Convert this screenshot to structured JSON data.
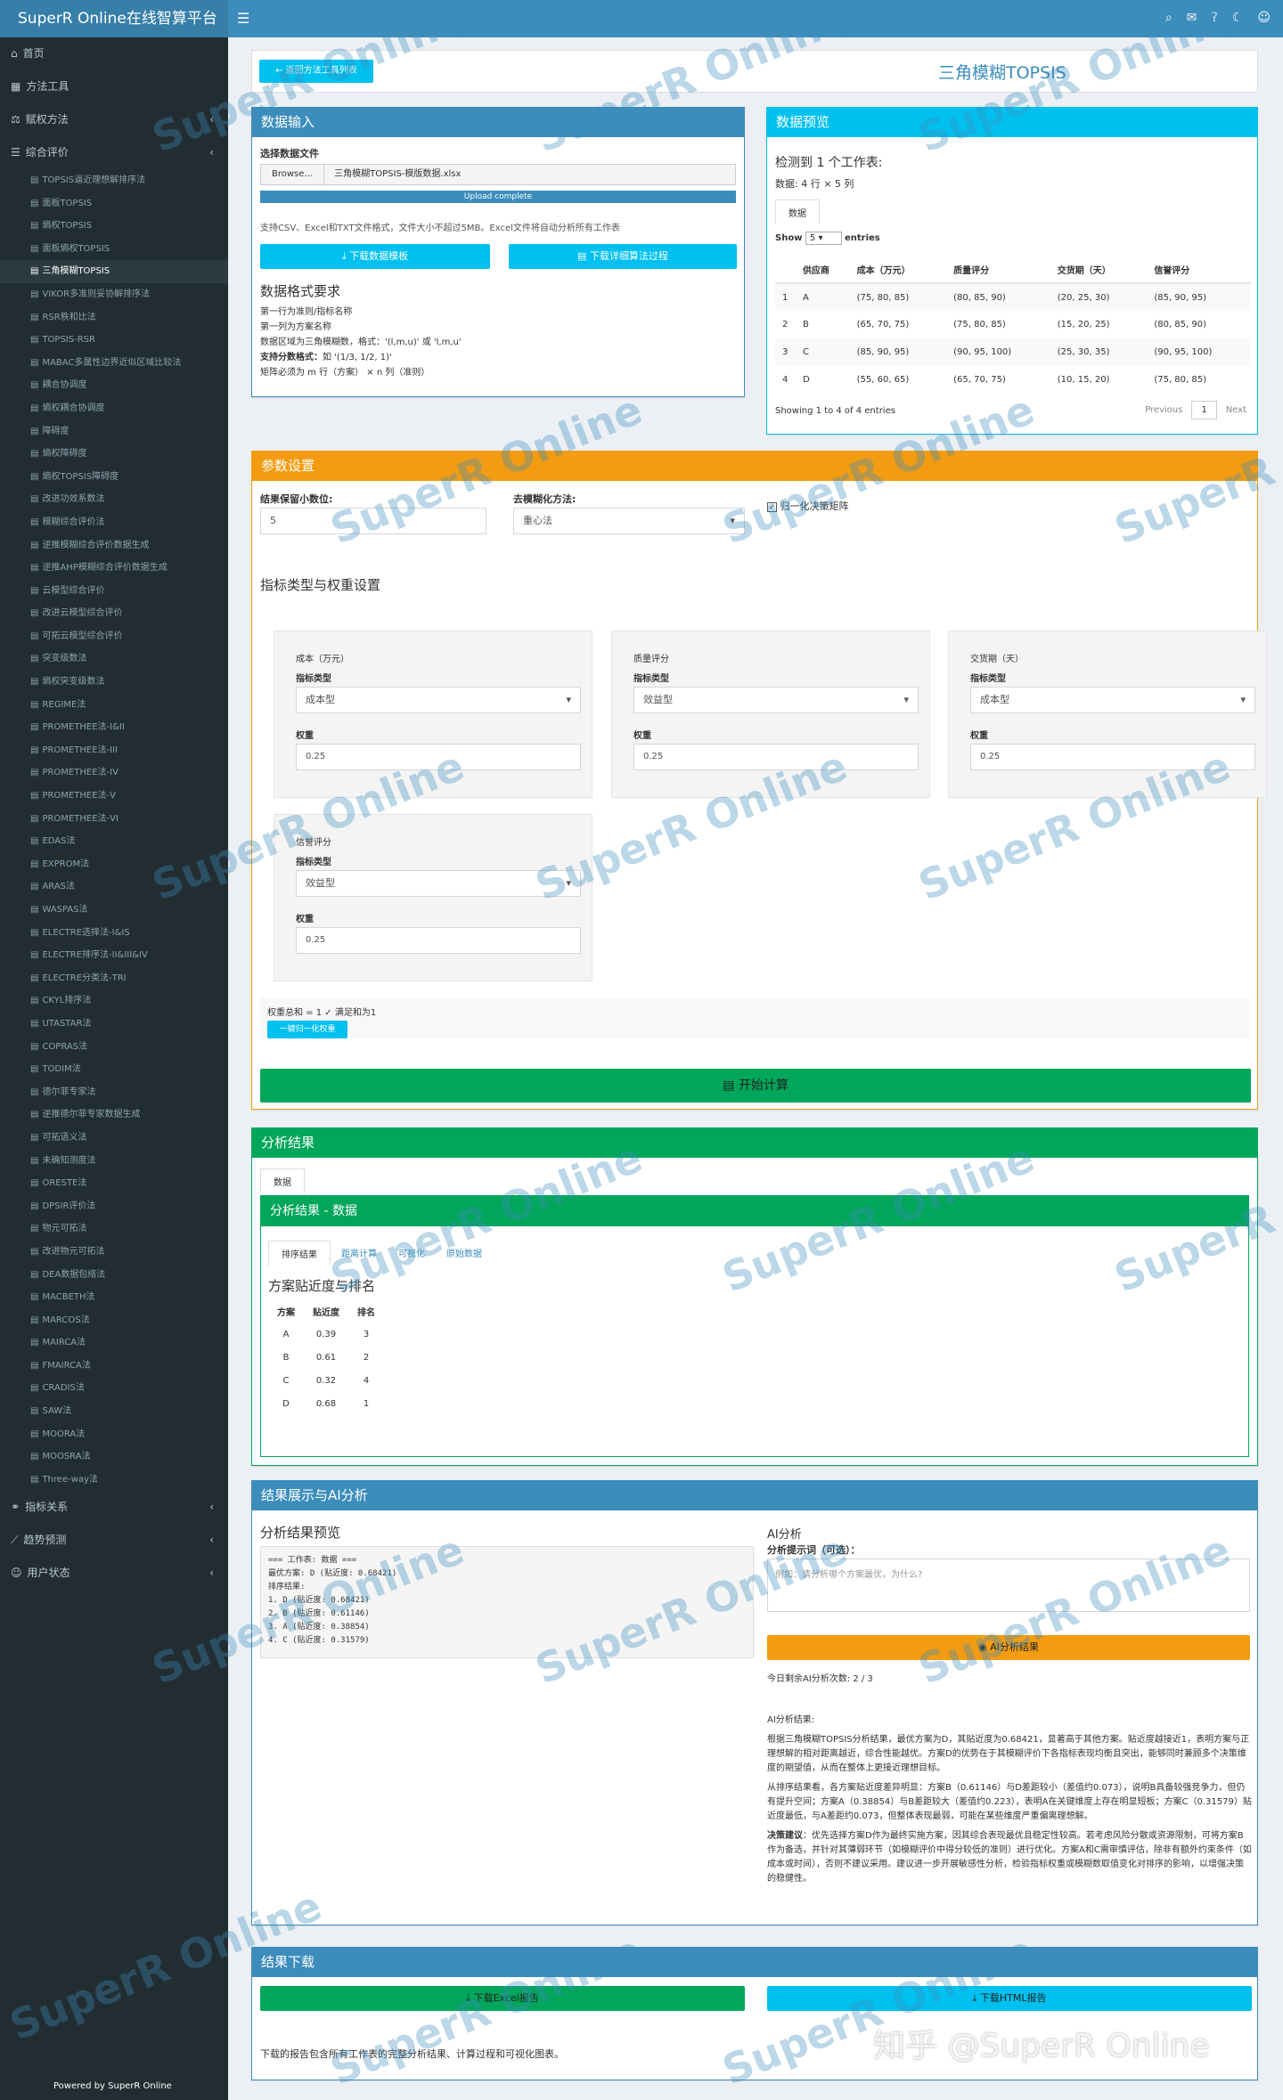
{
  "header": {
    "brand": "SuperR Online在线智算平台",
    "menu_icon": "hamburger-icon",
    "icons": [
      "search-icon",
      "megaphone-icon",
      "help-icon",
      "moon-icon",
      "user-icon"
    ]
  },
  "sidebar": {
    "top_before": [
      {
        "label": "首页",
        "icon": "home-icon"
      },
      {
        "label": "方法工具",
        "icon": "grid-icon"
      },
      {
        "label": "赋权方法",
        "icon": "balance-icon",
        "chevron": true
      },
      {
        "label": "综合评价",
        "icon": "list-icon",
        "chevron": true
      }
    ],
    "sub_items": [
      "TOPSIS逼近理想解排序法",
      "面板TOPSIS",
      "熵权TOPSIS",
      "面板熵权TOPSIS",
      "三角模糊TOPSIS",
      "VIKOR多准则妥协解排序法",
      "RSR秩和比法",
      "TOPSIS-RSR",
      "MABAC多属性边界近似区域比较法",
      "耦合协调度",
      "熵权耦合协调度",
      "障碍度",
      "熵权障碍度",
      "熵权TOPSIS障碍度",
      "改进功效系数法",
      "模糊综合评价法",
      "逆推模糊综合评价数据生成",
      "逆推AHP模糊综合评价数据生成",
      "云模型综合评价",
      "改进云模型综合评价",
      "可拓云模型综合评价",
      "突变级数法",
      "熵权突变级数法",
      "REGIME法",
      "PROMETHEE法-I&II",
      "PROMETHEE法-III",
      "PROMETHEE法-IV",
      "PROMETHEE法-V",
      "PROMETHEE法-VI",
      "EDAS法",
      "EXPROM法",
      "ARAS法",
      "WASPAS法",
      "ELECTRE选择法-I&IS",
      "ELECTRE排序法-II&III&IV",
      "ELECTRE分类法-TRI",
      "CKYL排序法",
      "UTASTAR法",
      "COPRAS法",
      "TODIM法",
      "德尔菲专家法",
      "逆推德尔菲专家数据生成",
      "可拓语义法",
      "未确知测度法",
      "ORESTE法",
      "DPSIR评价法",
      "物元可拓法",
      "改进物元可拓法",
      "DEA数据包络法",
      "MACBETH法",
      "MARCOS法",
      "MAIRCA法",
      "FMAIRCA法",
      "CRADIS法",
      "SAW法",
      "MOORA法",
      "MOOSRA法",
      "Three-way法"
    ],
    "active_index": 4,
    "top_after": [
      {
        "label": "指标关系",
        "icon": "link-icon"
      },
      {
        "label": "趋势预测",
        "icon": "chart-line-icon"
      },
      {
        "label": "用户状态",
        "icon": "user-icon"
      }
    ],
    "footer": "Powered by SuperR Online"
  },
  "title_bar": {
    "back_button": "← 返回方法工具列表",
    "title": "三角模糊TOPSIS"
  },
  "data_input": {
    "header": "数据输入",
    "file_label": "选择数据文件",
    "browse": "Browse...",
    "filename": "三角模糊TOPSIS-模版数据.xlsx",
    "progress": "Upload complete",
    "progress_value": 100,
    "support_text": "支持CSV、Excel和TXT文件格式，文件大小不超过5MB。Excel文件将自动分析所有工作表",
    "download_template": "下载数据模板",
    "download_detail": "下载详细算法过程",
    "format_title": "数据格式要求",
    "format_lines": [
      "第一行为准则/指标名称",
      "第一列为方案名称",
      "数据区域为三角模糊数，格式：'(l,m,u)' 或 'l,m,u'"
    ],
    "format_bold": "支持分数格式：",
    "format_bold_rest": "如 '(1/3, 1/2, 1)'",
    "format_last": "矩阵必须为 m 行（方案） × n 列（准则）"
  },
  "data_preview": {
    "header": "数据预览",
    "detected": "检测到 1 个工作表:",
    "dims": "数据: 4 行 × 5 列",
    "tab": "数据",
    "show": "Show",
    "show_value": "5",
    "entries": "entries",
    "columns": [
      "",
      "供应商",
      "成本（万元）",
      "质量评分",
      "交货期（天）",
      "信誉评分"
    ],
    "rows": [
      [
        "1",
        "A",
        "(75, 80, 85)",
        "(80, 85, 90)",
        "(20, 25, 30)",
        "(85, 90, 95)"
      ],
      [
        "2",
        "B",
        "(65, 70, 75)",
        "(75, 80, 85)",
        "(15, 20, 25)",
        "(80, 85, 90)"
      ],
      [
        "3",
        "C",
        "(85, 90, 95)",
        "(90, 95, 100)",
        "(25, 30, 35)",
        "(90, 95, 100)"
      ],
      [
        "4",
        "D",
        "(55, 60, 65)",
        "(65, 70, 75)",
        "(10, 15, 20)",
        "(75, 80, 85)"
      ]
    ],
    "showing": "Showing 1 to 4 of 4 entries",
    "previous": "Previous",
    "page": "1",
    "next": "Next"
  },
  "params": {
    "header": "参数设置",
    "decimals_label": "结果保留小数位:",
    "decimals_value": "5",
    "defuzz_label": "去模糊化方法:",
    "defuzz_value": "重心法",
    "normalize_label": "归一化决策矩阵",
    "section_title": "指标类型与权重设置",
    "type_label": "指标类型",
    "weight_label": "权重",
    "criteria": [
      {
        "name": "成本（万元）",
        "type": "成本型",
        "weight": "0.25"
      },
      {
        "name": "质量评分",
        "type": "效益型",
        "weight": "0.25"
      },
      {
        "name": "交货期（天）",
        "type": "成本型",
        "weight": "0.25"
      },
      {
        "name": "信誉评分",
        "type": "效益型",
        "weight": "0.25"
      }
    ],
    "weight_sum": "权重总和 = 1 ✓ 满足和为1",
    "normalize_btn": "一键归一化权重",
    "start_btn": "开始计算"
  },
  "results": {
    "header": "分析结果",
    "tab": "数据",
    "inner_header": "分析结果 - 数据",
    "tabs": [
      "排序结果",
      "距离计算",
      "可视化",
      "原始数据"
    ],
    "title": "方案贴近度与排名",
    "columns": [
      "方案",
      "贴近度",
      "排名"
    ],
    "rows": [
      [
        "A",
        "0.39",
        "3"
      ],
      [
        "B",
        "0.61",
        "2"
      ],
      [
        "C",
        "0.32",
        "4"
      ],
      [
        "D",
        "0.68",
        "1"
      ]
    ]
  },
  "ai": {
    "header": "结果展示与AI分析",
    "preview_title": "分析结果预览",
    "preview_lines": [
      "=== 工作表: 数据 ===",
      "最优方案: D (贴近度: 0.68421)",
      "排序结果:",
      "1. D (贴近度: 0.68421)",
      "2. B (贴近度: 0.61146)",
      "3. A (贴近度: 0.38854)",
      "4. C (贴近度: 0.31579)"
    ],
    "ai_title": "AI分析",
    "prompt_label": "分析提示词（可选）：",
    "prompt_placeholder": "例如：请分析哪个方案最优，为什么?",
    "ai_btn": "AI分析结果",
    "remaining": "今日剩余AI分析次数: 2 / 3",
    "result_label": "AI分析结果:",
    "p1": "根据三角模糊TOPSIS分析结果，最优方案为D，其贴近度为0.68421，显著高于其他方案。贴近度越接近1，表明方案与正理想解的相对距离越近，综合性能越优。方案D的优势在于其模糊评价下各指标表现均衡且突出，能够同时兼顾多个决策维度的期望值，从而在整体上更接近理想目标。",
    "p2": "从排序结果看，各方案贴近度差异明显：方案B（0.61146）与D差距较小（差值约0.073），说明B具备较强竞争力，但仍有提升空间；方案A（0.38854）与B差距较大（差值约0.223），表明A在关键维度上存在明显短板；方案C（0.31579）贴近度最低，与A差距约0.073，但整体表现最弱，可能在某些维度严重偏离理想解。",
    "p3_bold": "决策建议",
    "p3": "：优先选择方案D作为最终实施方案，因其综合表现最优且稳定性较高。若考虑风险分散或资源限制，可将方案B作为备选，并针对其薄弱环节（如模糊评价中得分较低的准则）进行优化。方案A和C需审慎评估，除非有额外约束条件（如成本或时间），否则不建议采用。建议进一步开展敏感性分析，检验指标权重或模糊数取值变化对排序的影响，以增强决策的稳健性。"
  },
  "download": {
    "header": "结果下载",
    "excel_btn": "下载Excel报告",
    "html_btn": "下载HTML报告",
    "note": "下载的报告包含所有工作表的完整分析结果、计算过程和可视化图表。"
  },
  "watermarks": {
    "text": "SuperR Online",
    "corner": "知乎 @SuperR Online"
  }
}
